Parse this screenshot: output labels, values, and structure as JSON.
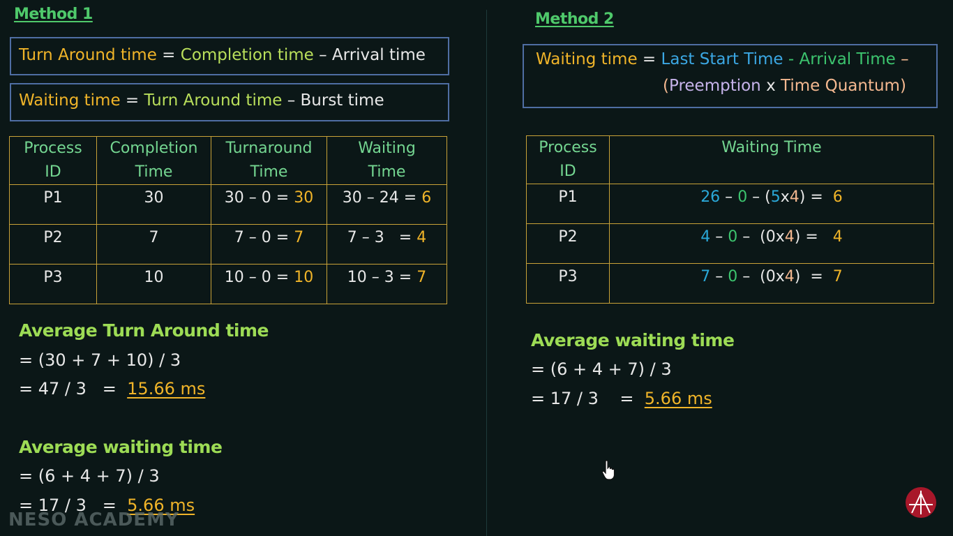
{
  "method1": {
    "heading": "Method 1",
    "formula_tat": {
      "lhs": "Turn Around time",
      "eq": " = ",
      "a": "Completion time",
      "op": " – ",
      "b": "Arrival time"
    },
    "formula_wt": {
      "lhs": "Waiting time",
      "eq": " = ",
      "a": "Turn Around time",
      "op": " – ",
      "b": "Burst time"
    },
    "table": {
      "headers": [
        [
          "Process",
          "ID"
        ],
        [
          "Completion",
          "Time"
        ],
        [
          "Turnaround",
          "Time"
        ],
        [
          "Waiting",
          "Time"
        ]
      ],
      "rows": [
        {
          "pid": "P1",
          "completion": "30",
          "tat_expr": "30 – 0 = ",
          "tat_val": "30",
          "wt_expr": "30 – 24 = ",
          "wt_val": "6"
        },
        {
          "pid": "P2",
          "completion": "7",
          "tat_expr": "7 – 0 = ",
          "tat_val": "7",
          "wt_expr": "7 – 3   = ",
          "wt_val": "4"
        },
        {
          "pid": "P3",
          "completion": "10",
          "tat_expr": "10 – 0 = ",
          "tat_val": "10",
          "wt_expr": "10 – 3 = ",
          "wt_val": "7"
        }
      ]
    },
    "avg_tat": {
      "title": "Average Turn Around time",
      "line1": "= (30 + 7 + 10) / 3",
      "line2": "= 47 / 3   =  ",
      "result": "15.66 ms"
    },
    "avg_wt": {
      "title": "Average waiting time",
      "line1": "= (6 + 4 + 7) / 3",
      "line2": "= 17 / 3   =  ",
      "result": "5.66 ms"
    }
  },
  "method2": {
    "heading": "Method 2",
    "formula": {
      "lhs": "Waiting time",
      "eq": " = ",
      "a": "Last Start Time",
      "op1": " - ",
      "b": "Arrival Time",
      "op2": " –",
      "open": "(",
      "c": "Preemption",
      "x": " x ",
      "d": "Time Quantum",
      "close": ")"
    },
    "table": {
      "headers": [
        [
          "Process",
          "ID"
        ],
        [
          "Waiting Time"
        ]
      ],
      "rows": [
        {
          "pid": "P1",
          "a": "26",
          "s1": " – ",
          "b": "0",
          "s2": " – (",
          "p": "5",
          "x": "x",
          "q": "4",
          "s3": ") =  ",
          "v": "6"
        },
        {
          "pid": "P2",
          "a": "4",
          "s1": " – ",
          "b": "0",
          "s2": " –  (",
          "p": "0",
          "x": "x",
          "q": "4",
          "s3": ") =   ",
          "v": "4"
        },
        {
          "pid": "P3",
          "a": "7",
          "s1": " – ",
          "b": "0",
          "s2": " –  (",
          "p": "0",
          "x": "x",
          "q": "4",
          "s3": ")  =  ",
          "v": "7"
        }
      ]
    },
    "avg_wt": {
      "title": "Average waiting time",
      "line1": "= (6 + 4 + 7) / 3",
      "line2": "= 17 / 3    =  ",
      "result": "5.66 ms"
    }
  },
  "watermark": "NESO ACADEMY",
  "colors": {
    "background": "#0b1717",
    "heading_green": "#4fc96b",
    "result_orange": "#f0b429",
    "table_border": "#c9a238",
    "box_border": "#4f6ea3"
  }
}
